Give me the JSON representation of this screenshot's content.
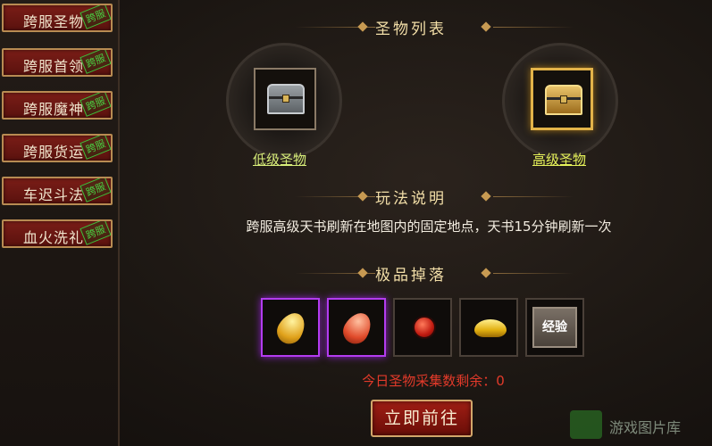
{
  "sidebar": {
    "items": [
      {
        "label": "跨服圣物",
        "stamp": "跨服"
      },
      {
        "label": "跨服首领",
        "stamp": "跨服"
      },
      {
        "label": "跨服魔神",
        "stamp": "跨服"
      },
      {
        "label": "跨服货运",
        "stamp": "跨服"
      },
      {
        "label": "车迟斗法",
        "stamp": "跨服"
      },
      {
        "label": "血火洗礼",
        "stamp": "跨服"
      }
    ]
  },
  "sections": {
    "relic_list": "圣物列表",
    "how_to_play": "玩法说明",
    "top_drops": "极品掉落"
  },
  "relics": {
    "low": "低级圣物",
    "high": "高级圣物"
  },
  "description": "跨服高级天书刷新在地图内的固定地点，天书15分钟刷新一次",
  "drops": {
    "exp_label": "经验"
  },
  "remaining_text": "今日圣物采集数剩余：0",
  "go_button": "立即前往",
  "watermark": "游戏图片库",
  "colors": {
    "accent_gold": "#e2b349",
    "button_red": "#a01e14",
    "warning_red": "#e23a2a",
    "link_yellow": "#e6f25a",
    "rare_purple": "#b33cf0"
  }
}
